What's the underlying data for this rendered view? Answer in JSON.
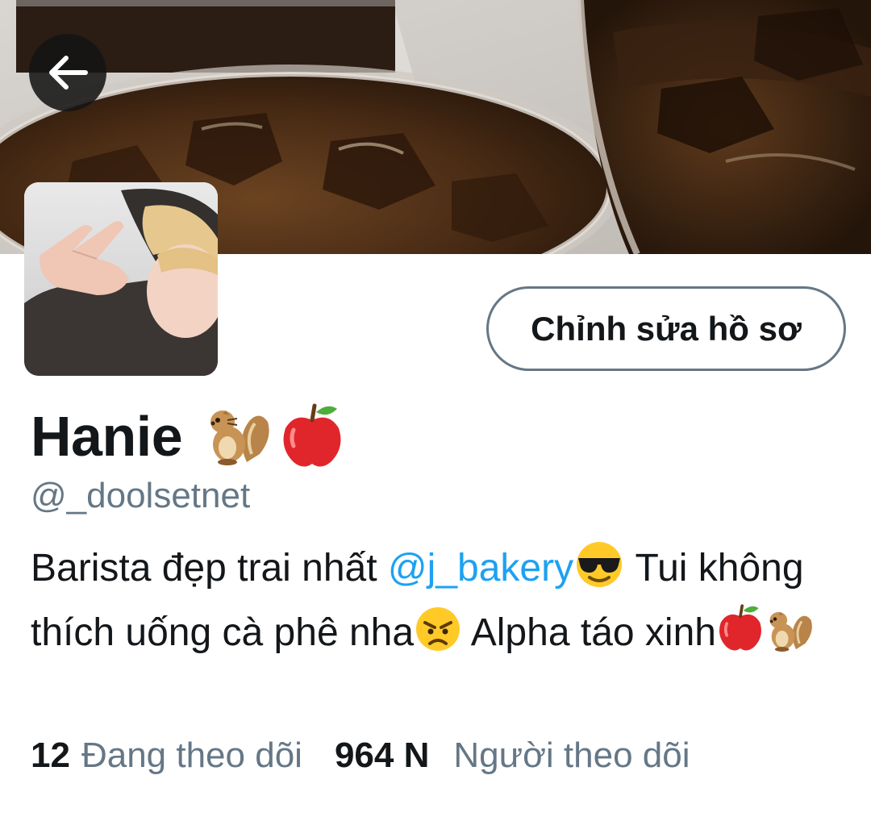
{
  "profile": {
    "display_name": "Hanie",
    "name_emojis": [
      "chipmunk-emoji",
      "red-apple-emoji"
    ],
    "handle": "@_doolsetnet",
    "bio": {
      "part1": "Barista đẹp trai nhất ",
      "mention": "@j_bakery",
      "part2": " Tui không thích uống cà phê nha",
      "part3": " Alpha táo xinh"
    }
  },
  "actions": {
    "edit_profile_label": "Chỉnh sửa hồ sơ"
  },
  "stats": {
    "following_count": "12",
    "following_label": "Đang theo dõi",
    "followers_count": "964 N",
    "followers_label": "Người theo dõi"
  },
  "icons": {
    "back": "arrow-left-icon"
  },
  "colors": {
    "text_primary": "#14171a",
    "text_secondary": "#657786",
    "link": "#1da1f2",
    "button_border": "#657786"
  }
}
